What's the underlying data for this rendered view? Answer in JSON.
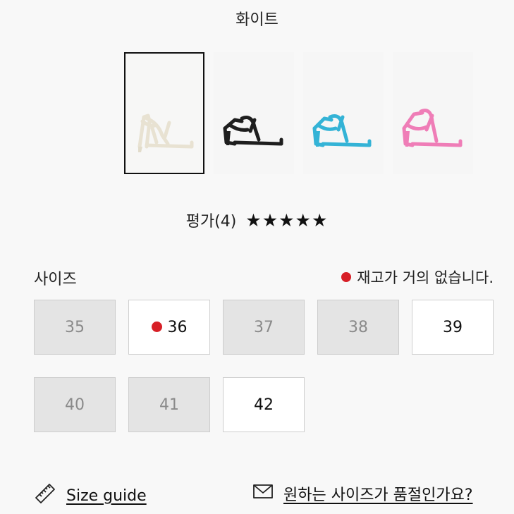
{
  "product": {
    "color_name": "화이트",
    "swatches": [
      {
        "name": "white",
        "color": "#f1ece0",
        "selected": true
      },
      {
        "name": "black",
        "color": "#1e1e1e",
        "selected": false
      },
      {
        "name": "blue",
        "color": "#34b3d6",
        "selected": false
      },
      {
        "name": "pink",
        "color": "#ef7db7",
        "selected": false
      }
    ]
  },
  "rating": {
    "label": "평가(4)",
    "stars": "★★★★★",
    "value": 5
  },
  "sizes": {
    "label": "사이즈",
    "low_stock_note": "재고가 거의 없습니다.",
    "low_stock_color": "#d71f26",
    "options": [
      {
        "value": "35",
        "available": false,
        "low_stock": false
      },
      {
        "value": "36",
        "available": true,
        "low_stock": true
      },
      {
        "value": "37",
        "available": false,
        "low_stock": false
      },
      {
        "value": "38",
        "available": false,
        "low_stock": false
      },
      {
        "value": "39",
        "available": true,
        "low_stock": false
      },
      {
        "value": "40",
        "available": false,
        "low_stock": false
      },
      {
        "value": "41",
        "available": false,
        "low_stock": false
      },
      {
        "value": "42",
        "available": true,
        "low_stock": false
      }
    ]
  },
  "links": {
    "size_guide": "Size guide",
    "size_guide_icon": "ruler-icon",
    "sold_out_inquiry": "원하는 사이즈가 품절인가요?",
    "sold_out_icon": "mail-icon"
  }
}
